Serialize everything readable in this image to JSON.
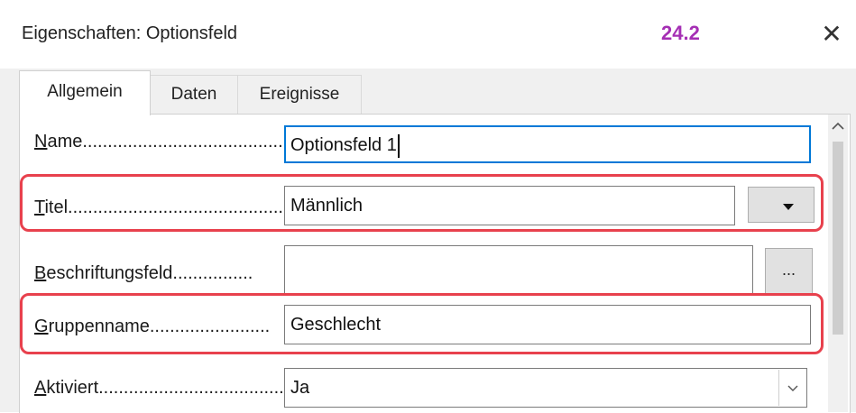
{
  "window": {
    "title": "Eigenschaften: Optionsfeld",
    "version_badge": "24.2",
    "close_symbol": "✕"
  },
  "tabs": [
    {
      "label": "Allgemein",
      "active": true
    },
    {
      "label": "Daten",
      "active": false
    },
    {
      "label": "Ereignisse",
      "active": false
    }
  ],
  "fields": {
    "name": {
      "mnemonic": "N",
      "label_rest": "ame.........................................",
      "value": "Optionsfeld 1"
    },
    "titel": {
      "mnemonic": "T",
      "label_rest": "itel.............................................",
      "value": "Männlich"
    },
    "beschriftungsfeld": {
      "mnemonic": "B",
      "label_rest": "eschriftungsfeld................",
      "value": "",
      "button_label": "..."
    },
    "gruppenname": {
      "mnemonic": "G",
      "label_rest": "ruppenname........................",
      "value": "Geschlecht"
    },
    "aktiviert": {
      "mnemonic": "A",
      "label_rest": "ktiviert......................................",
      "value": "Ja"
    }
  },
  "icons": {
    "close": "close-icon",
    "scroll_up": "chevron-up-icon",
    "dropdown": "triangle-down-icon",
    "combo": "chevron-down-icon"
  },
  "colors": {
    "version_badge": "#a52fb4",
    "highlight": "#e8414d",
    "focus_border": "#0078d7"
  }
}
